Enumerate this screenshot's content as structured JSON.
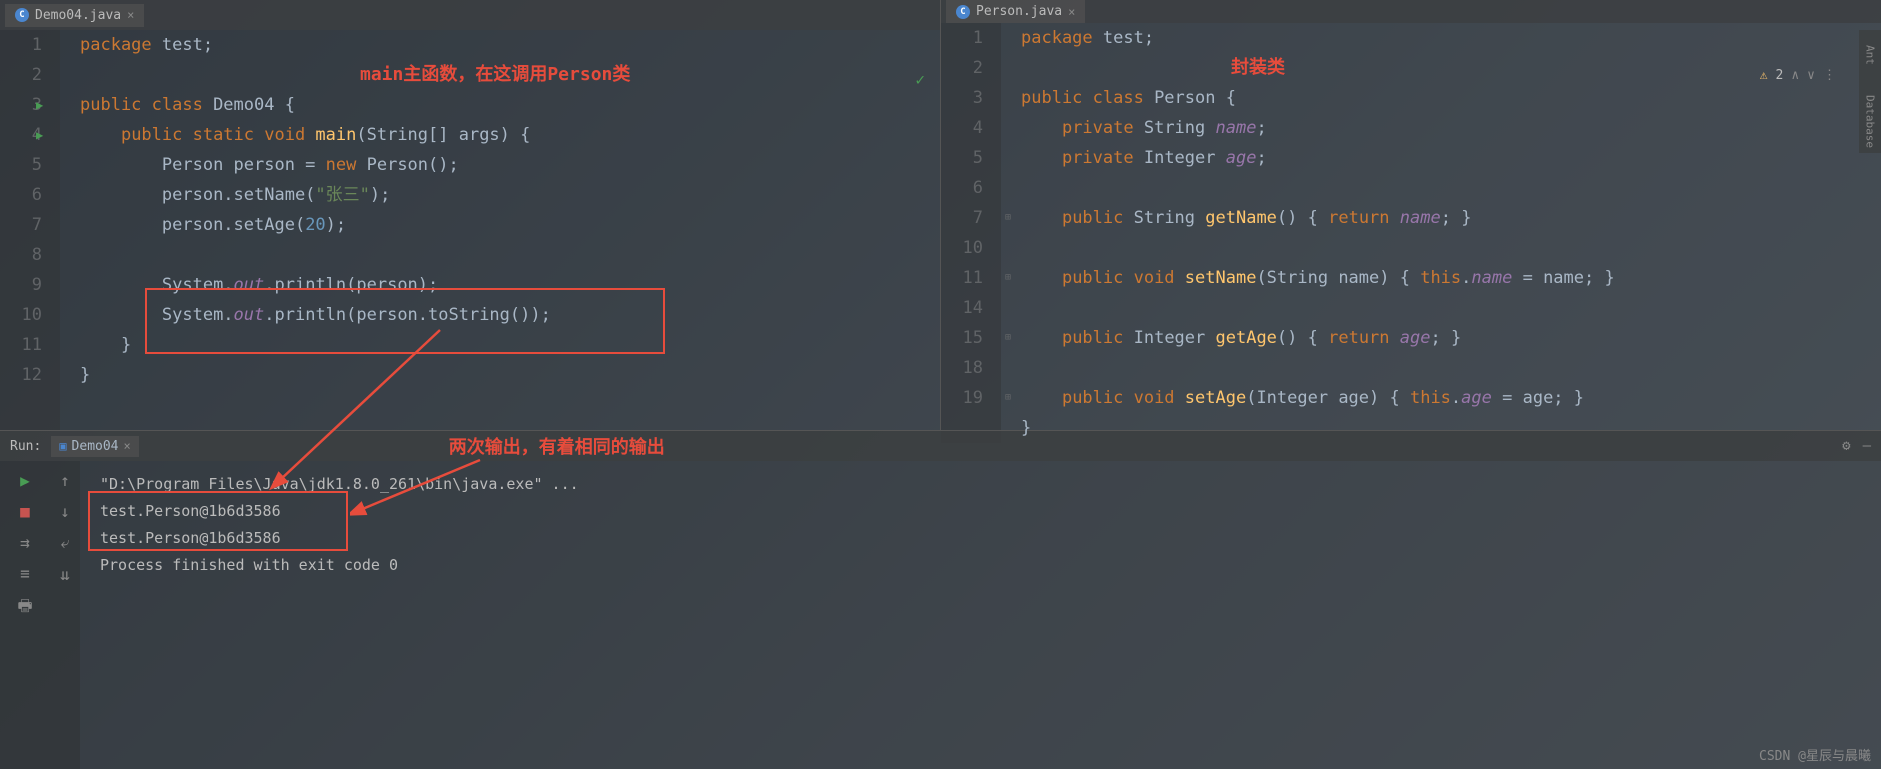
{
  "tabs": {
    "left": {
      "name": "Demo04.java"
    },
    "right": {
      "name": "Person.java"
    }
  },
  "left_code": {
    "lines": [
      "1",
      "2",
      "3",
      "4",
      "5",
      "6",
      "7",
      "8",
      "9",
      "10",
      "11",
      "12"
    ],
    "l1_kw1": "package",
    "l1_pkg": " test;",
    "l3_kw1": "public class",
    "l3_cls": " Demo04 {",
    "l4_kw1": "public static void",
    "l4_fn": " main",
    "l4_rest": "(String[] args) {",
    "l5_a": "Person person = ",
    "l5_kw": "new",
    "l5_b": " Person();",
    "l6_a": "person.setName(",
    "l6_str": "\"张三\"",
    "l6_b": ");",
    "l7_a": "person.setAge(",
    "l7_num": "20",
    "l7_b": ");",
    "l9_a": "System.",
    "l9_out": "out",
    "l9_b": ".println(person);",
    "l10_a": "System.",
    "l10_out": "out",
    "l10_b": ".println(person.toString());",
    "l11": "}",
    "l12": "}"
  },
  "right_code": {
    "lines": [
      "1",
      "2",
      "3",
      "4",
      "5",
      "6",
      "7",
      "10",
      "11",
      "14",
      "15",
      "18",
      "19",
      ""
    ],
    "l1_kw": "package",
    "l1_rest": " test;",
    "l3_kw": "public class",
    "l3_rest": " Person {",
    "l4_kw": "private",
    "l4_type": " String ",
    "l4_name": "name",
    "l4_end": ";",
    "l5_kw": "private",
    "l5_type": " Integer ",
    "l5_name": "age",
    "l5_end": ";",
    "l7_kw": "public",
    "l7_type": " String ",
    "l7_fn": "getName",
    "l7_a": "() { ",
    "l7_ret": "return",
    "l7_b": " ",
    "l7_field": "name",
    "l7_c": "; }",
    "l11_kw": "public void",
    "l11_fn": " setName",
    "l11_a": "(String name) { ",
    "l11_this": "this",
    "l11_b": ".",
    "l11_field": "name",
    "l11_c": " = name; }",
    "l15_kw": "public",
    "l15_type": " Integer ",
    "l15_fn": "getAge",
    "l15_a": "() { ",
    "l15_ret": "return",
    "l15_b": " ",
    "l15_field": "age",
    "l15_c": "; }",
    "l19_kw": "public void",
    "l19_fn": " setAge",
    "l19_a": "(Integer age) { ",
    "l19_this": "this",
    "l19_b": ".",
    "l19_field": "age",
    "l19_c": " = age; }",
    "l_end": "}"
  },
  "annotations": {
    "main_note": "main主函数，在这调用Person类",
    "class_note": "封装类",
    "output_note": "两次输出，有着相同的输出"
  },
  "warnings": {
    "count": "2"
  },
  "console": {
    "run_label": "Run:",
    "config_name": "Demo04",
    "cmd": "\"D:\\Program Files\\Java\\jdk1.8.0_261\\bin\\java.exe\" ...",
    "out1": "test.Person@1b6d3586",
    "out2": "test.Person@1b6d3586",
    "exit": "Process finished with exit code 0"
  },
  "side": {
    "ant": "Ant",
    "db": "Database"
  },
  "watermark": "CSDN @星辰与晨曦"
}
